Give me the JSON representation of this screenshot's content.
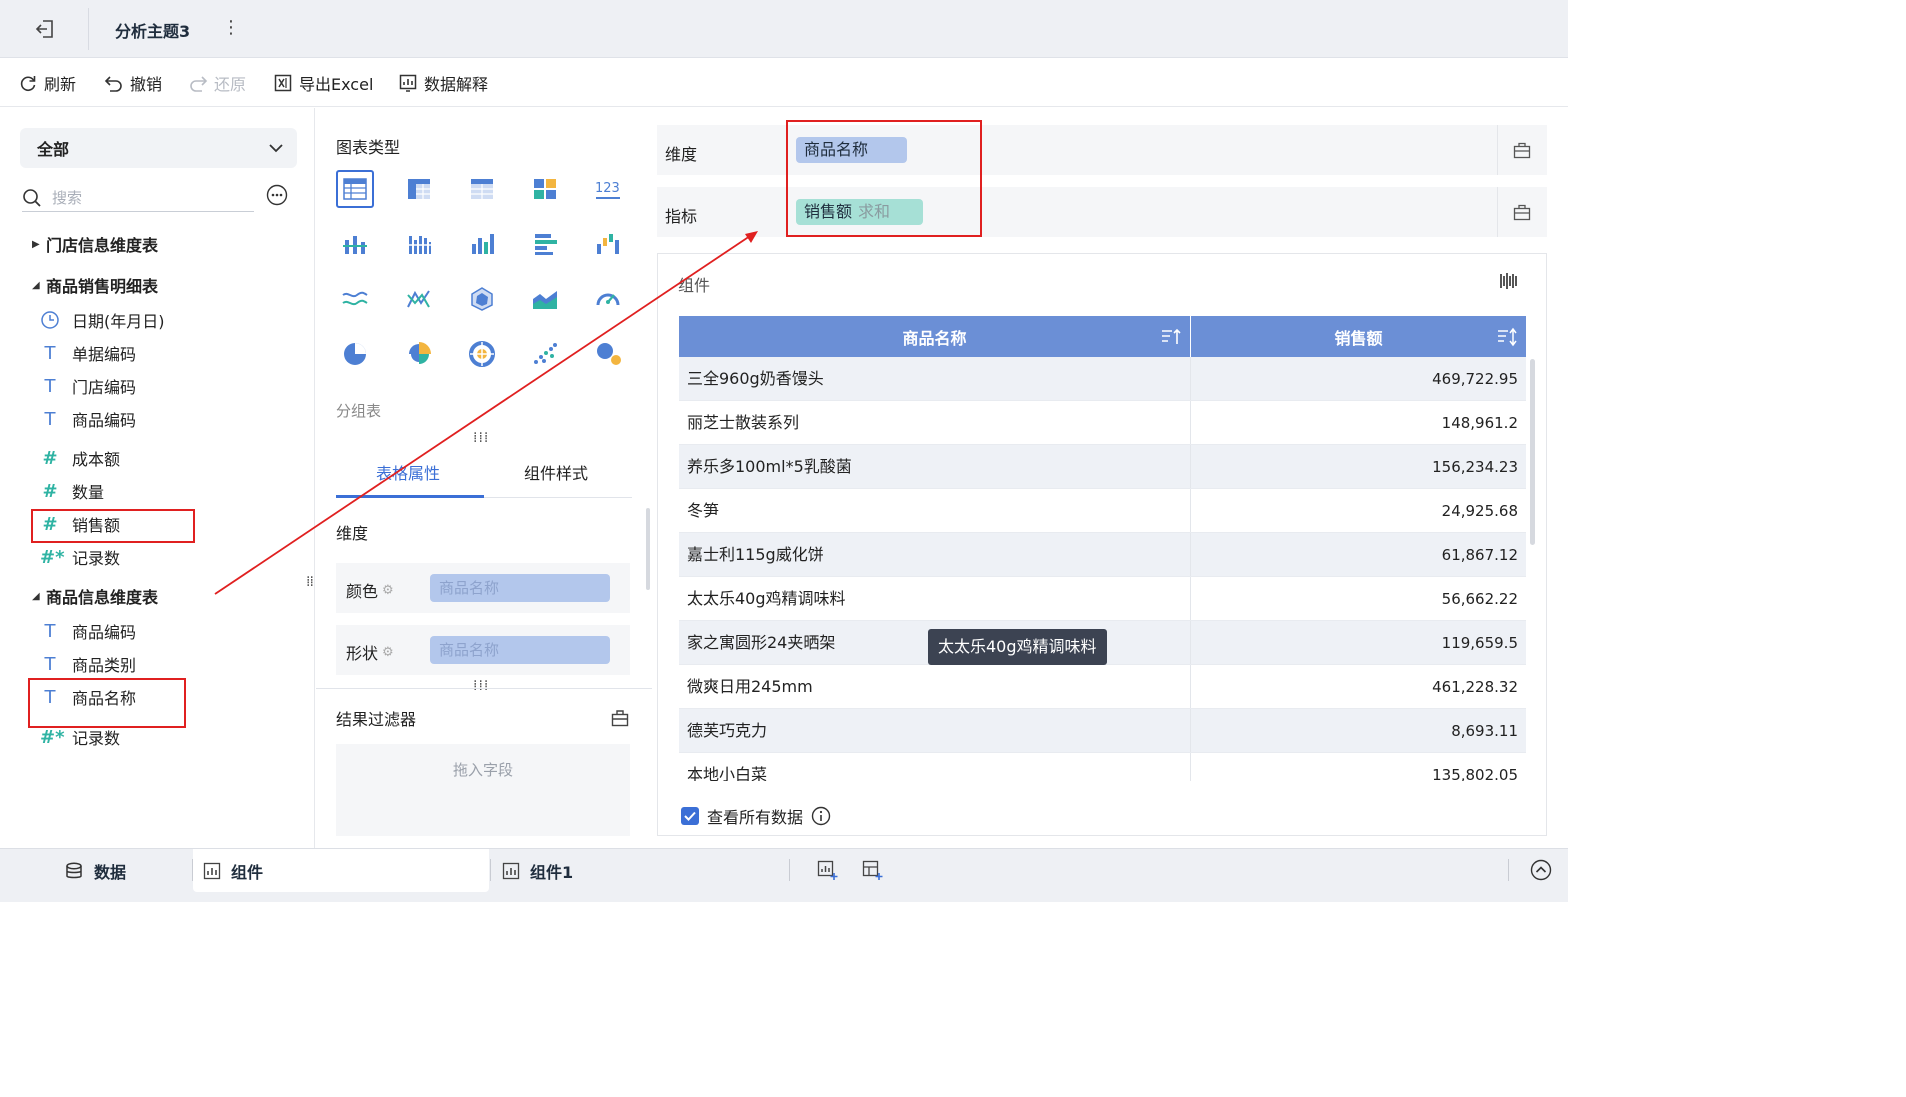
{
  "titlebar": {
    "title": "分析主题3",
    "more": "⋮"
  },
  "toolbar": {
    "refresh": "刷新",
    "undo": "撤销",
    "redo": "还原",
    "export": "导出Excel",
    "explain": "数据解释"
  },
  "left": {
    "selector": "全部",
    "search_placeholder": "搜索",
    "tree": [
      {
        "label": "门店信息维度表",
        "type": "group",
        "expanded": false
      },
      {
        "label": "商品销售明细表",
        "type": "group",
        "expanded": true
      },
      {
        "label": "日期(年月日)",
        "type": "date"
      },
      {
        "label": "单据编码",
        "type": "text"
      },
      {
        "label": "门店编码",
        "type": "text"
      },
      {
        "label": "商品编码",
        "type": "text"
      },
      {
        "label": "成本额",
        "type": "number"
      },
      {
        "label": "数量",
        "type": "number"
      },
      {
        "label": "销售额",
        "type": "number"
      },
      {
        "label": "记录数",
        "type": "count"
      },
      {
        "label": "商品信息维度表",
        "type": "group",
        "expanded": true
      },
      {
        "label": "商品编码",
        "type": "text"
      },
      {
        "label": "商品类别",
        "type": "text"
      },
      {
        "label": "商品名称",
        "type": "text"
      },
      {
        "label": "记录数",
        "type": "count"
      }
    ]
  },
  "middle": {
    "chart_types_title": "图表类型",
    "group_table_label": "分组表",
    "tabs": [
      "表格属性",
      "组件样式"
    ],
    "active_tab": 0,
    "dimension_section": "维度",
    "color_label": "颜色",
    "color_value": "商品名称",
    "shape_label": "形状",
    "shape_value": "商品名称",
    "filter_title": "结果过滤器",
    "filter_placeholder": "拖入字段",
    "gear": "⚙"
  },
  "right": {
    "dimension_label": "维度",
    "dimension_chip": "商品名称",
    "measure_label": "指标",
    "measure_chip": "销售额",
    "measure_agg": "求和",
    "component_title": "组件",
    "table": {
      "headers": [
        "商品名称",
        "销售额"
      ],
      "rows": [
        [
          "三全960g奶香馒头",
          "469,722.95"
        ],
        [
          "丽芝士散装系列",
          "148,961.2"
        ],
        [
          "养乐多100ml*5乳酸菌",
          "156,234.23"
        ],
        [
          "冬笋",
          "24,925.68"
        ],
        [
          "嘉士利115g威化饼",
          "61,867.12"
        ],
        [
          "太太乐40g鸡精调味料",
          "56,662.22"
        ],
        [
          "家之寓圆形24夹晒架",
          "119,659.5"
        ],
        [
          "微爽日用245mm",
          "461,228.32"
        ],
        [
          "德芙巧克力",
          "8,693.11"
        ],
        [
          "本地小白菜",
          "135,802.05"
        ]
      ]
    },
    "tooltip": "太太乐40g鸡精调味料",
    "view_all_label": "查看所有数据",
    "view_all_checked": true
  },
  "bottom": {
    "data_tab": "数据",
    "component_tab": "组件",
    "component1_tab": "组件1"
  },
  "colors": {
    "accent": "#3b6fd6",
    "table_header": "#6b8fd6",
    "dimension_chip": "#b3c7ec",
    "measure_chip": "#a6e0d6",
    "annotation_red": "#e02020"
  }
}
